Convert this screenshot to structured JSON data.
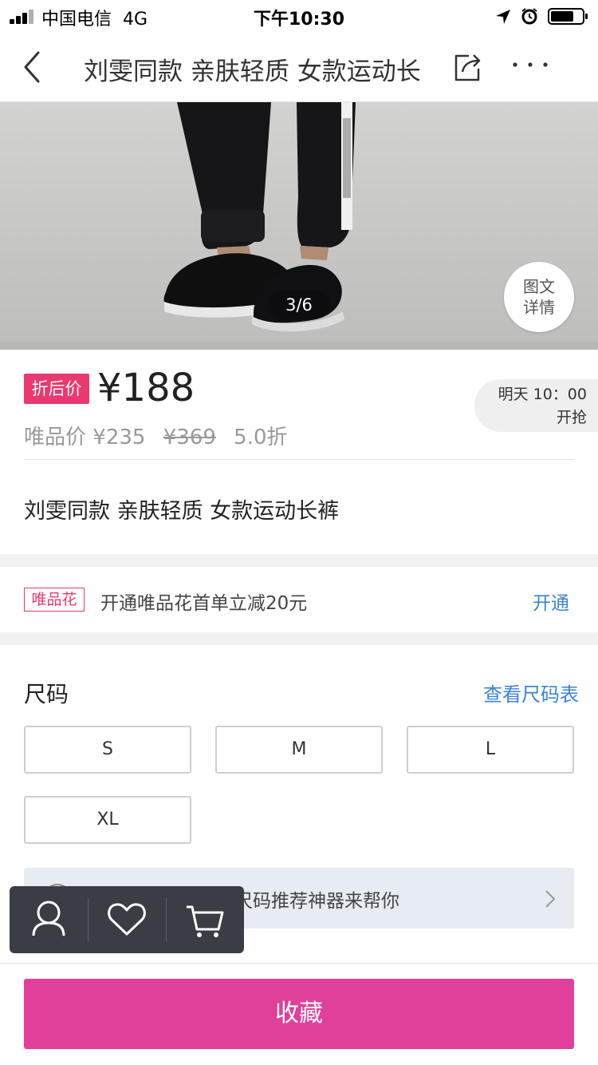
{
  "status_bar": {
    "carrier": "中国电信",
    "network": "4G",
    "time": "下午10:30"
  },
  "nav": {
    "title": "刘雯同款 亲肤轻质 女款运动长"
  },
  "gallery": {
    "counter": "3/6",
    "detail_line1": "图文",
    "detail_line2": "详情"
  },
  "price": {
    "tag": "折后价",
    "current": "¥188",
    "vip_label": "唯品价",
    "vip_price": "¥235",
    "original": "¥369",
    "discount": "5.0折"
  },
  "flash_sale": {
    "line1": "明天 10：00",
    "line2": "开抢"
  },
  "product": {
    "name": "刘雯同款 亲肤轻质 女款运动长裤"
  },
  "credit": {
    "badge": "唯品花",
    "text": "开通唯品花首单立减20元",
    "link": "开通"
  },
  "size": {
    "title": "尺码",
    "chart_link": "查看尺码表",
    "options": [
      "S",
      "M",
      "L",
      "XL"
    ],
    "recommend": "不知选什么码？让尺码推荐神器来帮你"
  },
  "bottom": {
    "favorite_label": "收藏"
  },
  "colors": {
    "accent_pink": "#e0409a",
    "price_tag": "#e9396f",
    "link_blue": "#3a83d6"
  }
}
